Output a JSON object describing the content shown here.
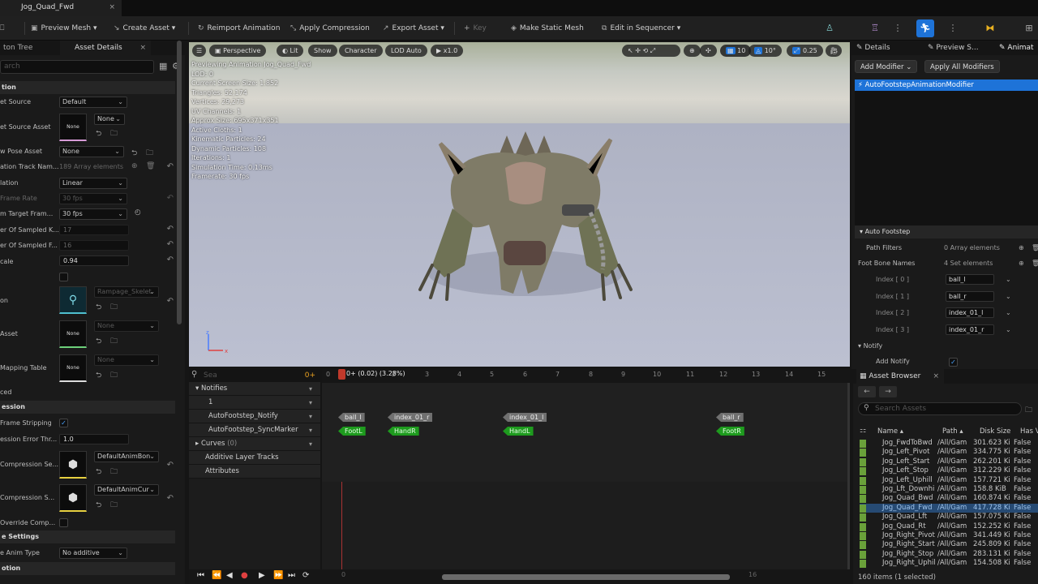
{
  "app": {
    "doc_tab": "Jog_Quad_Fwd"
  },
  "toolbar": {
    "preview_mesh": "Preview Mesh",
    "create_asset": "Create Asset",
    "reimport": "Reimport Animation",
    "apply_compression": "Apply Compression",
    "export_asset": "Export Asset",
    "key": "Key",
    "make_static_mesh": "Make Static Mesh",
    "edit_in_sequencer": "Edit in Sequencer"
  },
  "left": {
    "tab1": "ton Tree",
    "tab2": "Asset Details",
    "search_placeholder": "arch",
    "sections": {
      "animation": "tion",
      "compression": "ession",
      "additive": "e Settings",
      "root_motion": "otion"
    },
    "props": {
      "retarget_source": {
        "label": "et Source",
        "value": "Default"
      },
      "retarget_source_asset": {
        "label": "et Source Asset",
        "thumb": "None",
        "value": "None"
      },
      "preview_pose": {
        "label": "w Pose Asset",
        "value": "None"
      },
      "track_names": {
        "label": "ation Track Nam...",
        "value": "189 Array elements"
      },
      "interpolation": {
        "label": "lation",
        "value": "Linear"
      },
      "frame_rate": {
        "label": "Frame Rate",
        "value": "30 fps"
      },
      "target_frame": {
        "label": "m Target Fram...",
        "value": "30 fps"
      },
      "sampled_keys": {
        "label": "er Of Sampled K...",
        "value": "17"
      },
      "sampled_frames": {
        "label": "er Of Sampled F...",
        "value": "16"
      },
      "rate_scale": {
        "label": "cale",
        "value": "0.94"
      },
      "skeleton": {
        "label": "on",
        "value": "Rampage_Skelet"
      },
      "asset": {
        "label": "Asset",
        "thumb": "None",
        "value": "None"
      },
      "mapping_table": {
        "label": "Mapping Table",
        "thumb": "None",
        "value": "None"
      },
      "ced": {
        "label": "ced"
      },
      "frame_stripping": {
        "label": "Frame Stripping"
      },
      "error_threshold": {
        "label": "ession Error Thr...",
        "value": "1.0"
      },
      "compression_settings": {
        "label": "Compression Se...",
        "value": "DefaultAnimBon"
      },
      "curve_compression": {
        "label": "Compression S...",
        "value": "DefaultAnimCur"
      },
      "override_comp": {
        "label": "Override Comp..."
      },
      "anim_type": {
        "label": "e Anim Type",
        "value": "No additive"
      }
    }
  },
  "viewport": {
    "perspective": "Perspective",
    "lit": "Lit",
    "show": "Show",
    "character": "Character",
    "lod": "LOD Auto",
    "speed": "x1.0",
    "grid": "10",
    "angle": "10°",
    "scale": "0.25",
    "info": [
      "Previewing Animation Jog_Quad_Fwd",
      "LOD: 0",
      "Current Screen Size: 1.852",
      "Triangles: 52,174",
      "Vertices: 29,273",
      "UV Channels: 1",
      "Approx Size: 695x371x351",
      "Active Cloths: 1",
      "Kinematic Particles: 24",
      "Dynamic Particles: 108",
      "Iterations: 1",
      "Simulation Time: 0.13ms",
      "Framerate: 30 fps"
    ]
  },
  "timeline": {
    "search_placeholder": "Sea",
    "filter_label": "0+",
    "playhead_label": "0+ (0.02) (3.28%)",
    "ticks": [
      "0",
      "1",
      "2",
      "3",
      "4",
      "5",
      "6",
      "7",
      "8",
      "9",
      "10",
      "11",
      "12",
      "13",
      "14",
      "15"
    ],
    "tracks": {
      "notifies": "Notifies",
      "one": "1",
      "notify_track": "AutoFootstep_Notify",
      "sync_track": "AutoFootstep_SyncMarker",
      "curves": "Curves",
      "curves_count": "(0)",
      "additive": "Additive Layer Tracks",
      "attributes": "Attributes"
    },
    "notifies_gray": [
      "ball_l",
      "index_01_r",
      "index_01_l",
      "ball_r"
    ],
    "notifies_green": [
      "FootL",
      "HandR",
      "HandL",
      "FootR"
    ],
    "bottom_ticks": [
      "0",
      "16"
    ]
  },
  "right": {
    "tab_details": "Details",
    "tab_preview": "Preview S...",
    "tab_anim": "Animat",
    "add_modifier": "Add Modifier",
    "apply_all": "Apply All Modifiers",
    "modifier": "AutoFootstepAnimationModifier",
    "section": "Auto Footstep",
    "path_filters": "Path Filters",
    "path_filters_value": "0 Array elements",
    "foot_bones": "Foot Bone Names",
    "foot_bones_value": "4 Set elements",
    "index_labels": [
      "Index [ 0 ]",
      "Index [ 1 ]",
      "Index [ 2 ]",
      "Index [ 3 ]"
    ],
    "index_values": [
      "ball_l",
      "ball_r",
      "index_01_l",
      "index_01_r"
    ],
    "notify_section": "Notify",
    "add_notify": "Add Notify"
  },
  "asset_browser": {
    "tab": "Asset Browser",
    "search_placeholder": "Search Assets",
    "cols": [
      "Name",
      "Path",
      "Disk Size",
      "Has V"
    ],
    "rows": [
      [
        "Jog_FwdToBwd",
        "/All/Gam",
        "301.623 Ki",
        "False"
      ],
      [
        "Jog_Left_Pivot",
        "/All/Gam",
        "334.775 Ki",
        "False"
      ],
      [
        "Jog_Left_Start",
        "/All/Gam",
        "262.201 Ki",
        "False"
      ],
      [
        "Jog_Left_Stop",
        "/All/Gam",
        "312.229 Ki",
        "False"
      ],
      [
        "Jog_Left_Uphill",
        "/All/Gam",
        "157.721 Ki",
        "False"
      ],
      [
        "Jog_Lft_Downhi",
        "/All/Gam",
        "158.8 KiB",
        "False"
      ],
      [
        "Jog_Quad_Bwd",
        "/All/Gam",
        "160.874 Ki",
        "False"
      ],
      [
        "Jog_Quad_Fwd",
        "/All/Gam",
        "417.728 Ki",
        "False"
      ],
      [
        "Jog_Quad_Lft",
        "/All/Gam",
        "157.075 Ki",
        "False"
      ],
      [
        "Jog_Quad_Rt",
        "/All/Gam",
        "152.252 Ki",
        "False"
      ],
      [
        "Jog_Right_Pivot",
        "/All/Gam",
        "341.449 Ki",
        "False"
      ],
      [
        "Jog_Right_Start",
        "/All/Gam",
        "245.809 Ki",
        "False"
      ],
      [
        "Jog_Right_Stop",
        "/All/Gam",
        "283.131 Ki",
        "False"
      ],
      [
        "Jog_Right_Uphil",
        "/All/Gam",
        "154.508 Ki",
        "False"
      ]
    ],
    "selected_index": 7,
    "status": "160 items (1 selected)"
  }
}
